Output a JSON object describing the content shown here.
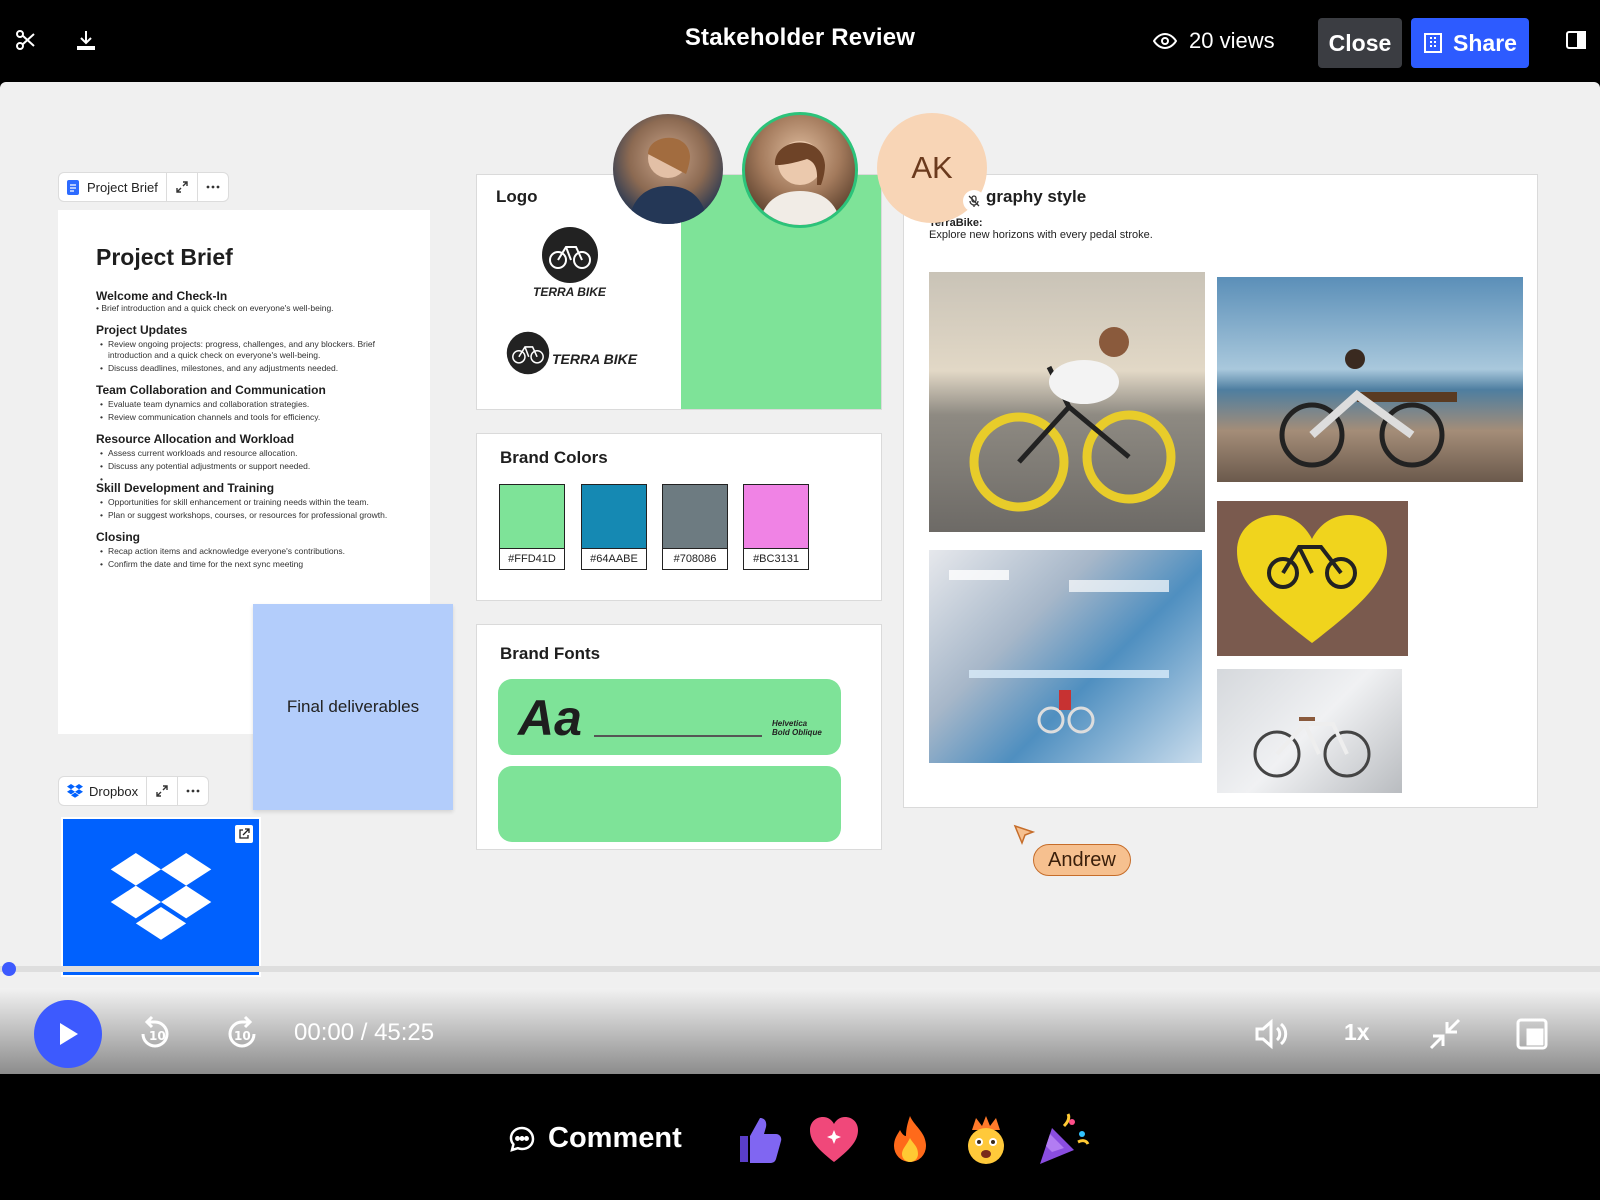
{
  "header": {
    "title": "Stakeholder Review",
    "views": "20 views",
    "close_label": "Close",
    "share_label": "Share"
  },
  "project_brief_widget": {
    "label": "Project Brief",
    "doc": {
      "title": "Project Brief",
      "s1_title": "Welcome and Check-In",
      "s1_text": "• Brief introduction and a quick check on everyone's well-being.",
      "s2_title": "Project Updates",
      "s2_b1": "Review ongoing projects: progress, challenges, and any blockers. Brief introduction and a quick check on everyone's well-being.",
      "s2_b2": "Discuss deadlines, milestones, and any adjustments needed.",
      "s3_title": "Team Collaboration and Communication",
      "s3_b1": "Evaluate team dynamics and collaboration strategies.",
      "s3_b2": "Review communication channels and tools for efficiency.",
      "s4_title": "Resource Allocation and Workload",
      "s4_b1": "Assess current workloads and resource allocation.",
      "s4_b2": "Discuss any potential adjustments or support needed.",
      "s5_title": "Skill Development and Training",
      "s5_b1": "Opportunities for skill enhancement or training needs within the team.",
      "s5_b2": "Plan or suggest workshops, courses, or resources for professional growth.",
      "s6_title": "Closing",
      "s6_b1": "Recap action items and acknowledge everyone's contributions.",
      "s6_b2": "Confirm the date and time for the next sync meeting"
    }
  },
  "sticky_note": {
    "text": "Final deliverables"
  },
  "dropbox_widget": {
    "label": "Dropbox"
  },
  "logo_panel": {
    "title": "Logo",
    "brand_name_1": "TERRA BIKE",
    "brand_name_2": "TERRA BIKE"
  },
  "brand_colors": {
    "title": "Brand Colors",
    "swatches": [
      {
        "label": "#FFD41D",
        "color": "#7ee398"
      },
      {
        "label": "#64AABE",
        "color": "#1589b3"
      },
      {
        "label": "#708086",
        "color": "#6d7b81"
      },
      {
        "label": "#BC3131",
        "color": "#f083e5"
      }
    ]
  },
  "brand_fonts": {
    "title": "Brand Fonts",
    "sample": "Aa",
    "font_name_line1": "Helvetica",
    "font_name_line2": "Bold Oblique"
  },
  "photography": {
    "title": "graphy style",
    "brand": "TerraBike:",
    "tagline": "Explore new horizons with every pedal stroke."
  },
  "participants": {
    "initials": "AK",
    "cursor_name": "Andrew"
  },
  "player": {
    "time": "00:00 / 45:25",
    "speed": "1x",
    "progress": 0
  },
  "reactions": {
    "comment_label": "Comment"
  },
  "colors": {
    "accent": "#3d5afe",
    "share": "#2d5bff",
    "green": "#7ee398",
    "cursor": "#f6c08f"
  }
}
